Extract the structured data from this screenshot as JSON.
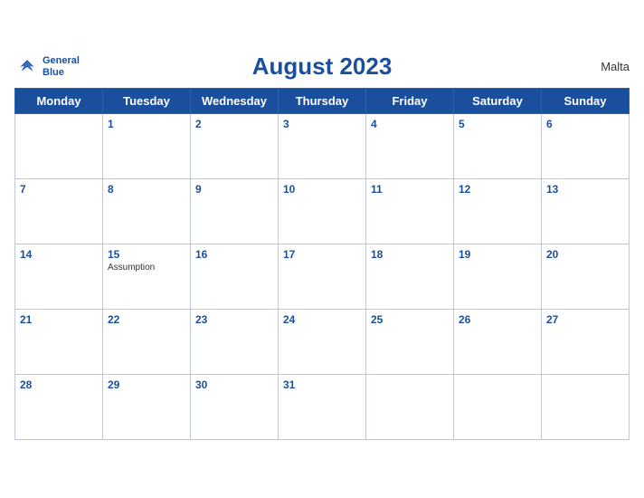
{
  "header": {
    "title": "August 2023",
    "country": "Malta",
    "logo_line1": "General",
    "logo_line2": "Blue"
  },
  "weekdays": [
    "Monday",
    "Tuesday",
    "Wednesday",
    "Thursday",
    "Friday",
    "Saturday",
    "Sunday"
  ],
  "weeks": [
    [
      {
        "day": "",
        "holiday": ""
      },
      {
        "day": "1",
        "holiday": ""
      },
      {
        "day": "2",
        "holiday": ""
      },
      {
        "day": "3",
        "holiday": ""
      },
      {
        "day": "4",
        "holiday": ""
      },
      {
        "day": "5",
        "holiday": ""
      },
      {
        "day": "6",
        "holiday": ""
      }
    ],
    [
      {
        "day": "7",
        "holiday": ""
      },
      {
        "day": "8",
        "holiday": ""
      },
      {
        "day": "9",
        "holiday": ""
      },
      {
        "day": "10",
        "holiday": ""
      },
      {
        "day": "11",
        "holiday": ""
      },
      {
        "day": "12",
        "holiday": ""
      },
      {
        "day": "13",
        "holiday": ""
      }
    ],
    [
      {
        "day": "14",
        "holiday": ""
      },
      {
        "day": "15",
        "holiday": "Assumption"
      },
      {
        "day": "16",
        "holiday": ""
      },
      {
        "day": "17",
        "holiday": ""
      },
      {
        "day": "18",
        "holiday": ""
      },
      {
        "day": "19",
        "holiday": ""
      },
      {
        "day": "20",
        "holiday": ""
      }
    ],
    [
      {
        "day": "21",
        "holiday": ""
      },
      {
        "day": "22",
        "holiday": ""
      },
      {
        "day": "23",
        "holiday": ""
      },
      {
        "day": "24",
        "holiday": ""
      },
      {
        "day": "25",
        "holiday": ""
      },
      {
        "day": "26",
        "holiday": ""
      },
      {
        "day": "27",
        "holiday": ""
      }
    ],
    [
      {
        "day": "28",
        "holiday": ""
      },
      {
        "day": "29",
        "holiday": ""
      },
      {
        "day": "30",
        "holiday": ""
      },
      {
        "day": "31",
        "holiday": ""
      },
      {
        "day": "",
        "holiday": ""
      },
      {
        "day": "",
        "holiday": ""
      },
      {
        "day": "",
        "holiday": ""
      }
    ]
  ],
  "colors": {
    "header_bg": "#1a4f9e",
    "header_text": "#ffffff",
    "border": "#c0c8d8",
    "day_number": "#1a4f9e",
    "title": "#1a4f9e"
  }
}
